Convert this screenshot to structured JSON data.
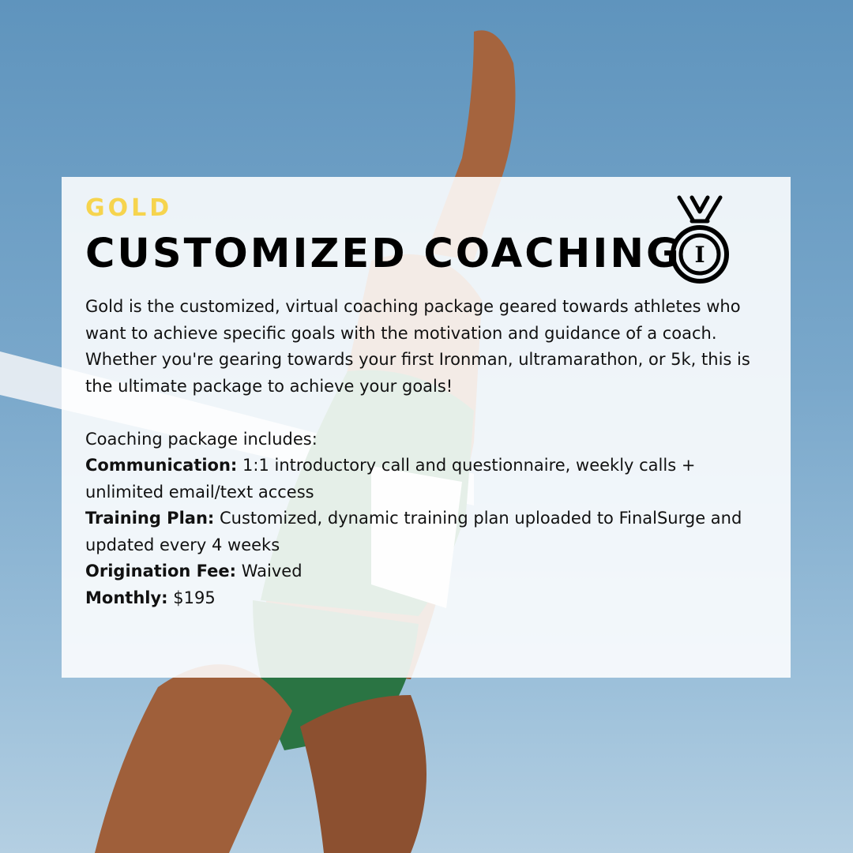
{
  "tier": "GOLD",
  "title": "CUSTOMIZED COACHING",
  "medal_icon": "medal-icon",
  "medal_label": "I",
  "colors": {
    "tier": "#f6d44e",
    "title": "#000000",
    "sky": "#6f9fc5"
  },
  "intro": "Gold is the customized, virtual coaching package geared towards athletes who want to achieve specific goals with the motivation and guidance of a coach. Whether you're gearing towards your first Ironman, ultramarathon, or 5k, this is the ultimate package to achieve your goals!",
  "includes_heading": "Coaching package includes:",
  "features": [
    {
      "label": "Communication:",
      "value": " 1:1 introductory call and questionnaire, weekly calls + unlimited email/text access"
    },
    {
      "label": "Training Plan:",
      "value": " Customized, dynamic training plan uploaded to FinalSurge and updated every 4 weeks"
    },
    {
      "label": "Origination Fee:",
      "value": " Waived"
    },
    {
      "label": "Monthly:",
      "value": " $195"
    }
  ]
}
